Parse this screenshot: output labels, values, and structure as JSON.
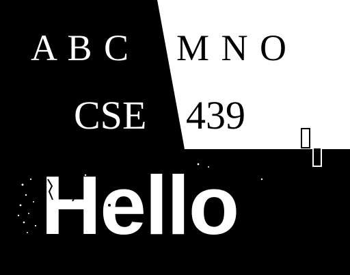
{
  "image": {
    "colors": {
      "background": "#000000",
      "white_panel": "#ffffff",
      "text_on_black": "#ffffff",
      "text_on_white": "#000000"
    },
    "text": {
      "letters_left": "A B C",
      "letters_right": "M N O",
      "course_left": "CSE",
      "course_right": "439",
      "hello": "Hello"
    }
  }
}
